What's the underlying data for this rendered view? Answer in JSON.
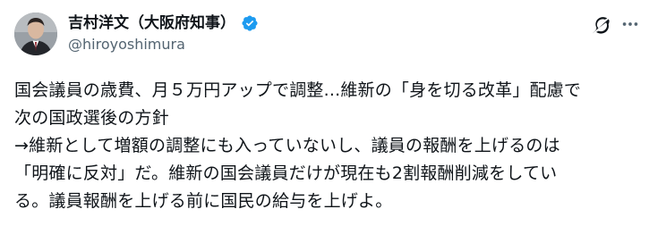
{
  "author": {
    "display_name": "吉村洋文（大阪府知事）",
    "handle": "@hiroyoshimura",
    "verified": true
  },
  "icons": {
    "avatar": "avatar-photo",
    "verified": "verified-badge-icon",
    "grok": "grok-icon",
    "more": "more-options-icon"
  },
  "colors": {
    "verified_blue": "#1d9bf0",
    "text_primary": "#0f1419",
    "text_secondary": "#536471"
  },
  "post": {
    "lines": [
      "国会議員の歳費、月５万円アップで調整...維新の「身を切る改革」配慮で",
      "次の国政選後の方針",
      "→維新として増額の調整にも入っていないし、議員の報酬を上げるのは",
      "「明確に反対」だ。維新の国会議員だけが現在も2割報酬削減をしてい",
      "る。議員報酬を上げる前に国民の給与を上げよ。"
    ]
  }
}
